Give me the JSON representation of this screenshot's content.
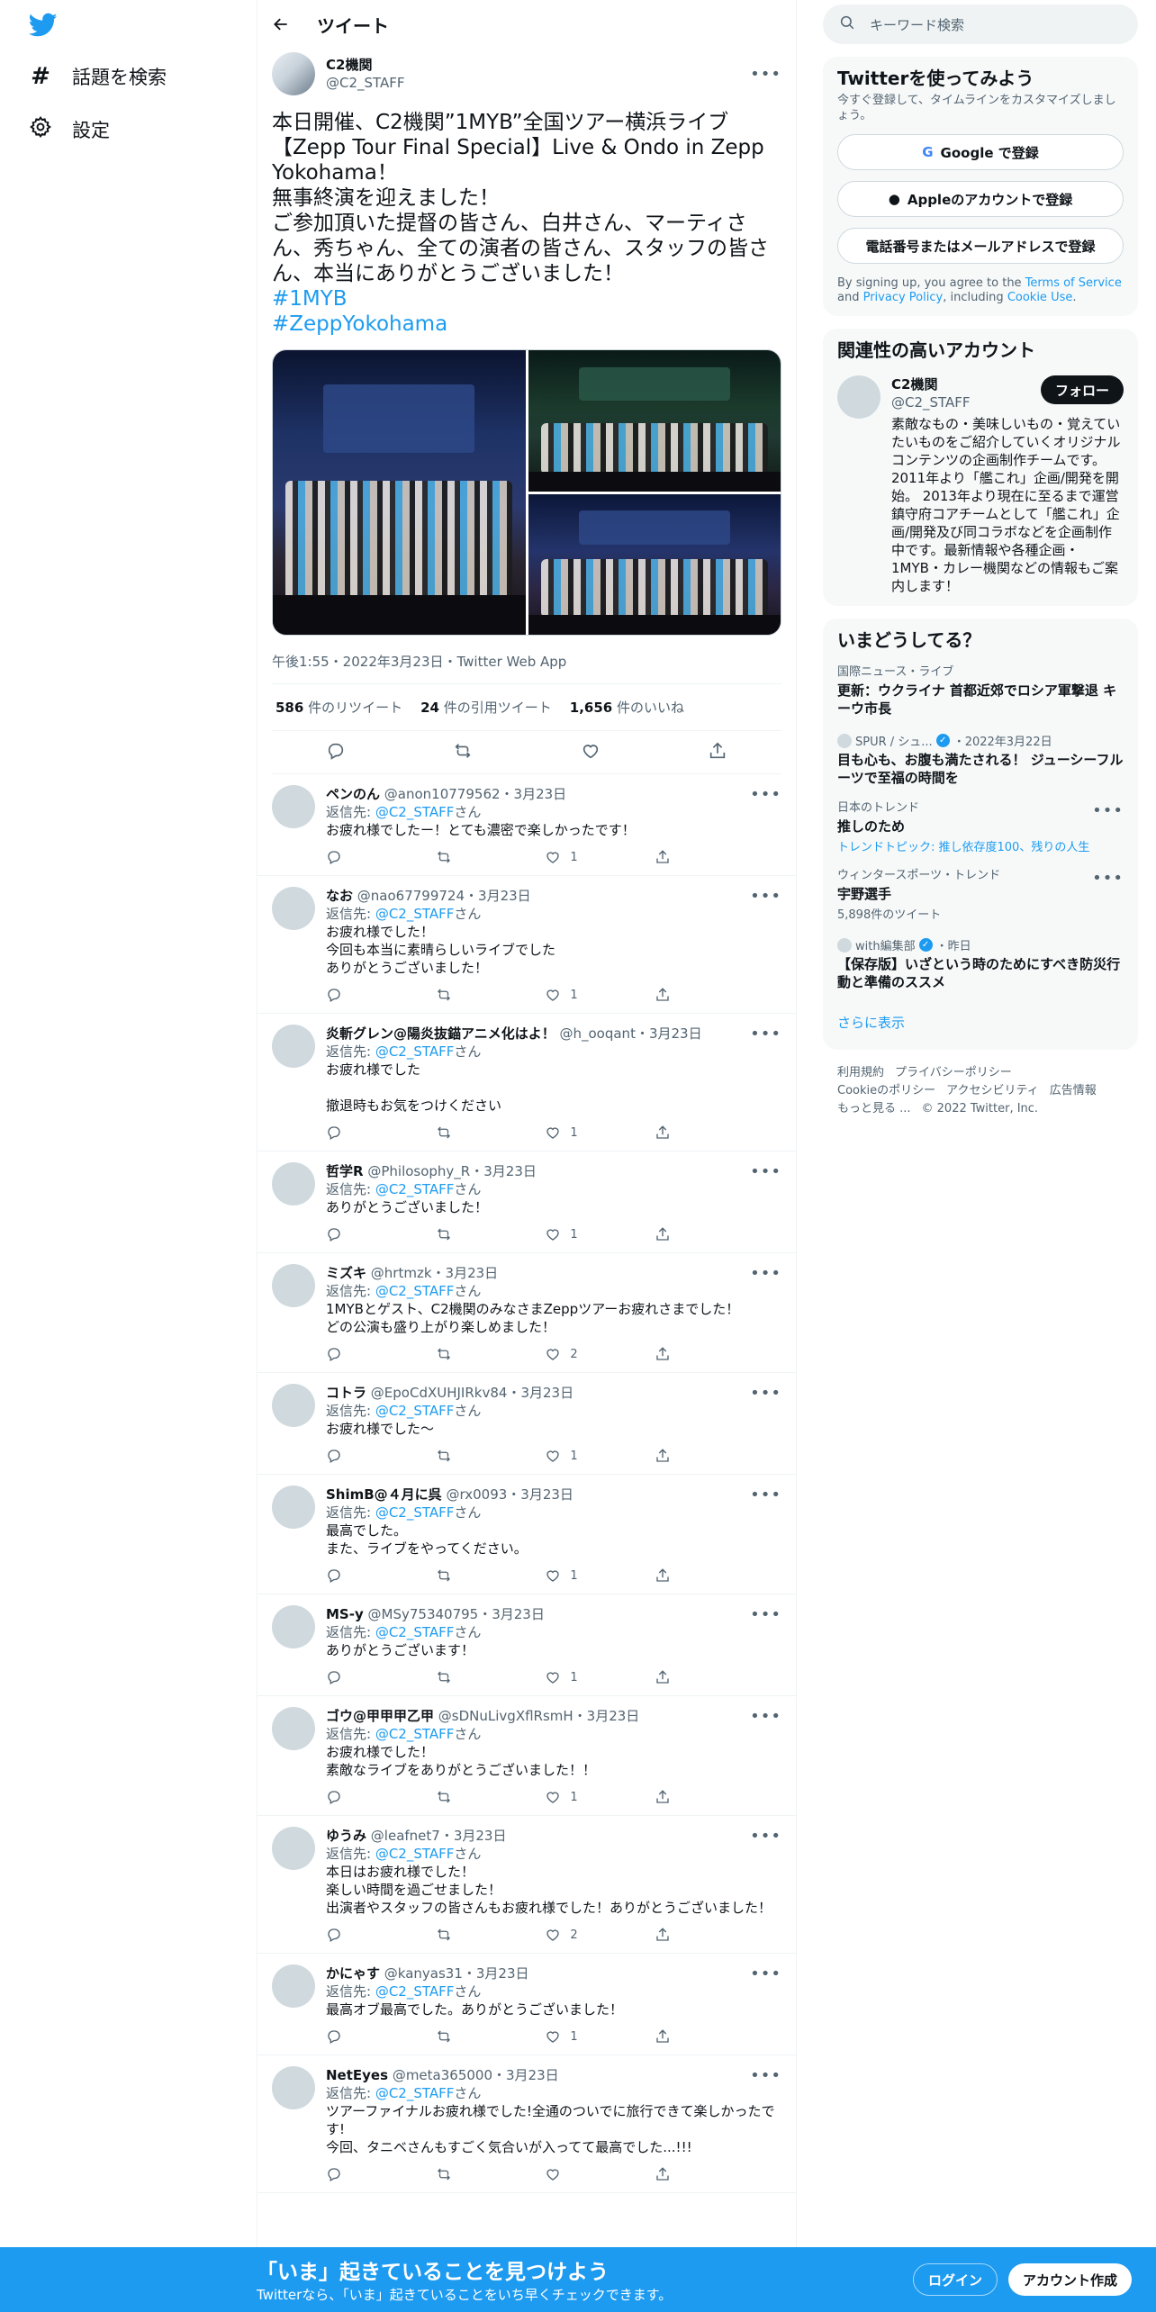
{
  "nav": {
    "explore_label": "話題を検索",
    "settings_label": "設定"
  },
  "header": {
    "title": "ツイート"
  },
  "main_tweet": {
    "name": "C2機関",
    "handle": "@C2_STAFF",
    "text": "本日開催、C2機関”1MYB”全国ツアー横浜ライブ【Zepp Tour Final Special】Live & Ondo in Zepp Yokohama！\n無事終演を迎えました！\nご参加頂いた提督の皆さん、白井さん、マーティさん、秀ちゃん、全ての演者の皆さん、スタッフの皆さん、本当にありがとうございました！",
    "hashtags": [
      "#1MYB",
      "#ZeppYokohama"
    ],
    "timestamp": "午後1:55・2022年3月23日・Twitter Web App",
    "stats": {
      "retweets": "586",
      "retweets_label": "件のリツイート",
      "quotes": "24",
      "quotes_label": "件の引用ツイート",
      "likes": "1,656",
      "likes_label": "件のいいね"
    }
  },
  "replies": [
    {
      "name": "ペンのん",
      "handle": "@anon10779562",
      "date": "・3月23日",
      "reply_prefix": "返信先: ",
      "reply_to": "@C2_STAFF",
      "reply_suffix": "さん",
      "text": "お疲れ様でしたー！とても濃密で楽しかったです！",
      "likes": "1"
    },
    {
      "name": "なお",
      "handle": "@nao67799724",
      "date": "・3月23日",
      "reply_prefix": "返信先: ",
      "reply_to": "@C2_STAFF",
      "reply_suffix": "さん",
      "text": "お疲れ様でした！\n今回も本当に素晴らしいライブでした\nありがとうございました！",
      "likes": "1"
    },
    {
      "name": "炎斬グレン@陽炎抜錨アニメ化はよ！",
      "handle": "@h_ooqant",
      "date": "・3月23日",
      "reply_prefix": "返信先: ",
      "reply_to": "@C2_STAFF",
      "reply_suffix": "さん",
      "text": "お疲れ様でした\n\n撤退時もお気をつけください",
      "likes": "1"
    },
    {
      "name": "哲学R",
      "handle": "@Philosophy_R",
      "date": "・3月23日",
      "reply_prefix": "返信先: ",
      "reply_to": "@C2_STAFF",
      "reply_suffix": "さん",
      "text": "ありがとうございました！",
      "likes": "1"
    },
    {
      "name": "ミズキ",
      "handle": "@hrtmzk",
      "date": "・3月23日",
      "reply_prefix": "返信先: ",
      "reply_to": "@C2_STAFF",
      "reply_suffix": "さん",
      "text": "1MYBとゲスト、C2機関のみなさまZeppツアーお疲れさまでした！\nどの公演も盛り上がり楽しめました！",
      "likes": "2"
    },
    {
      "name": "コトラ",
      "handle": "@EpoCdXUHJIRkv84",
      "date": "・3月23日",
      "reply_prefix": "返信先: ",
      "reply_to": "@C2_STAFF",
      "reply_suffix": "さん",
      "text": "お疲れ様でした～",
      "likes": "1"
    },
    {
      "name": "ShimB@４月に呉",
      "handle": "@rx0093",
      "date": "・3月23日",
      "reply_prefix": "返信先: ",
      "reply_to": "@C2_STAFF",
      "reply_suffix": "さん",
      "text": "最高でした。\nまた、ライブをやってください。",
      "likes": "1"
    },
    {
      "name": "MS-y",
      "handle": "@MSy75340795",
      "date": "・3月23日",
      "reply_prefix": "返信先: ",
      "reply_to": "@C2_STAFF",
      "reply_suffix": "さん",
      "text": "ありがとうございます！",
      "likes": "1"
    },
    {
      "name": "ゴウ@甲甲甲乙甲",
      "handle": "@sDNuLivgXflRsmH",
      "date": "・3月23日",
      "reply_prefix": "返信先: ",
      "reply_to": "@C2_STAFF",
      "reply_suffix": "さん",
      "text": "お疲れ様でした！\n素敵なライブをありがとうございました！！",
      "likes": "1"
    },
    {
      "name": "ゆうみ",
      "handle": "@leafnet7",
      "date": "・3月23日",
      "reply_prefix": "返信先: ",
      "reply_to": "@C2_STAFF",
      "reply_suffix": "さん",
      "text": "本日はお疲れ様でした！\n楽しい時間を過ごせました！\n出演者やスタッフの皆さんもお疲れ様でした！ありがとうございました！",
      "likes": "2"
    },
    {
      "name": "かにゃす",
      "handle": "@kanyas31",
      "date": "・3月23日",
      "reply_prefix": "返信先: ",
      "reply_to": "@C2_STAFF",
      "reply_suffix": "さん",
      "text": "最高オブ最高でした。ありがとうございました！",
      "likes": "1"
    },
    {
      "name": "NetEyes",
      "handle": "@meta365000",
      "date": "・3月23日",
      "reply_prefix": "返信先: ",
      "reply_to": "@C2_STAFF",
      "reply_suffix": "さん",
      "text": "ツアーファイナルお疲れ様でした!全通のついでに旅行できて楽しかったです!\n今回、タニベさんもすごく気合いが入ってて最高でした...!!!",
      "likes": ""
    }
  ],
  "search": {
    "placeholder": "キーワード検索"
  },
  "signup_card": {
    "title": "Twitterを使ってみよう",
    "subtitle": "今すぐ登録して、タイムラインをカスタマイズしましょう。",
    "google": "Google で登録",
    "apple": "Appleのアカウントで登録",
    "phone": "電話番号またはメールアドレスで登録",
    "terms_1": "By signing up, you agree to the ",
    "terms_link1": "Terms of Service",
    "terms_2": " and ",
    "terms_link2": "Privacy Policy",
    "terms_3": ", including ",
    "terms_link3": "Cookie Use",
    "terms_4": "."
  },
  "related": {
    "title": "関連性の高いアカウント",
    "name": "C2機関",
    "handle": "@C2_STAFF",
    "follow": "フォロー",
    "bio": "素敵なもの・美味しいもの・覚えていたいものをご紹介していくオリジナルコンテンツの企画制作チームです。2011年より「艦これ」企画/開発を開始。 2013年より現在に至るまで運営鎮守府コアチームとして「艦これ」企画/開発及び同コラボなどを企画制作中です。最新情報や各種企画・1MYB・カレー機関などの情報もご案内します！"
  },
  "trends": {
    "title": "いまどうしてる？",
    "items": [
      {
        "category": "国際ニュース・ライブ",
        "title": "更新：ウクライナ 首都近郊でロシア軍撃退 キーウ市長",
        "meta": ""
      },
      {
        "category": "SPUR / シュ...",
        "date": "・2022年3月22日",
        "title": "目も心も、お腹も満たされる！ ジューシーフルーツで至福の時間を",
        "meta": ""
      },
      {
        "category": "日本のトレンド",
        "title": "推しのため",
        "meta": "トレンドトピック: 推し依存度100、残りの人生"
      },
      {
        "category": "ウィンタースポーツ・トレンド",
        "title": "宇野選手",
        "meta": "5,898件のツイート"
      },
      {
        "category": "with編集部",
        "date": "・昨日",
        "title": "【保存版】いざという時のためにすべき防災行動と準備のススメ",
        "meta": ""
      }
    ],
    "show_more": "さらに表示"
  },
  "footer": {
    "links": [
      "利用規約",
      "プライバシーポリシー",
      "Cookieのポリシー",
      "アクセシビリティ",
      "広告情報",
      "もっと見る ...",
      "© 2022 Twitter, Inc."
    ]
  },
  "bottom_bar": {
    "title": "「いま」起きていることを見つけよう",
    "subtitle": "Twitterなら、「いま」起きていることをいち早くチェックできます。",
    "login": "ログイン",
    "signup": "アカウント作成"
  },
  "colors": {
    "accent": "#1d9bf0",
    "text": "#0f1419",
    "muted": "#536471"
  }
}
